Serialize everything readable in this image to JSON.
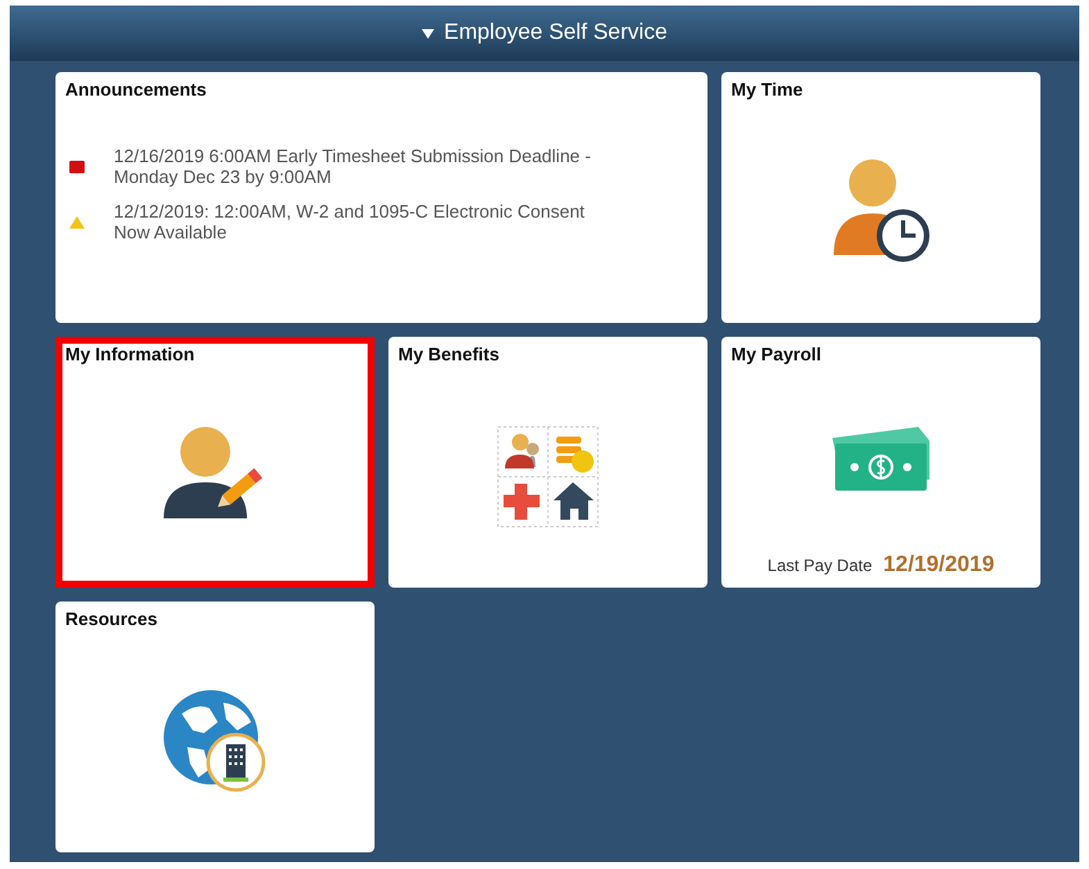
{
  "header": {
    "title": "Employee Self Service"
  },
  "tiles": [
    {
      "kind": "announcements",
      "title": "Announcements",
      "highlighted": false,
      "items": [
        {
          "kind": "urgent",
          "text": "12/16/2019 6:00AM Early Timesheet Submission Deadline - Monday Dec 23 by 9:00AM"
        },
        {
          "kind": "warning",
          "text": "12/12/2019: 12:00AM, W-2 and 1095-C Electronic Consent Now Available"
        }
      ]
    },
    {
      "kind": "time",
      "title": "My Time",
      "highlighted": false
    },
    {
      "kind": "information",
      "title": "My Information",
      "highlighted": true
    },
    {
      "kind": "benefits",
      "title": "My Benefits",
      "highlighted": false
    },
    {
      "kind": "payroll",
      "title": "My Payroll",
      "highlighted": false,
      "label": "Last Pay Date",
      "date": "12/19/2019"
    },
    {
      "kind": "resources",
      "title": "Resources",
      "highlighted": false
    }
  ]
}
